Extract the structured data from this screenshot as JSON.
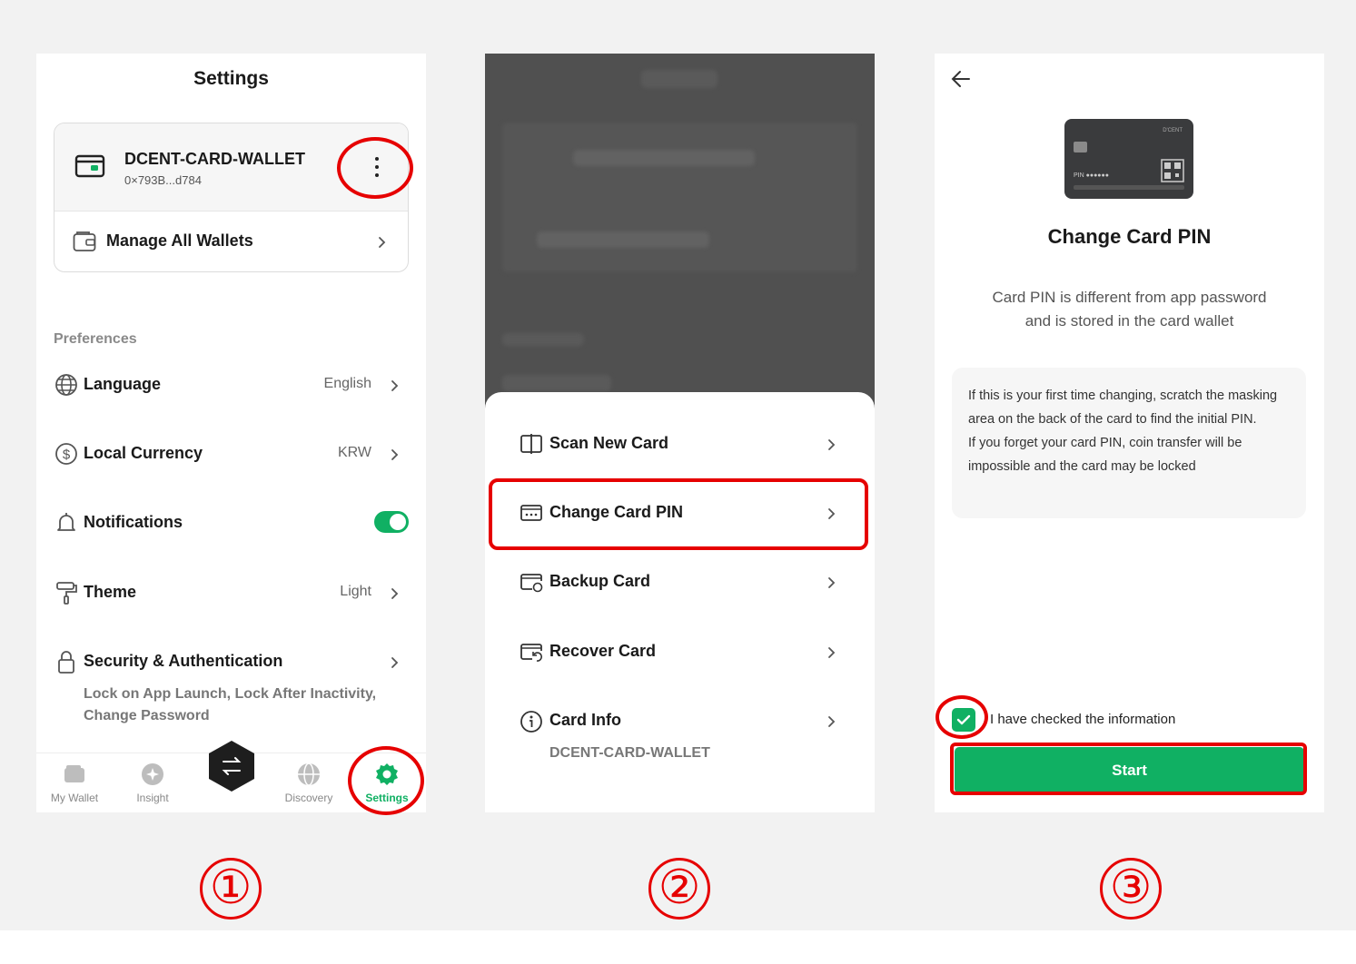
{
  "screen1": {
    "title": "Settings",
    "wallet": {
      "name": "DCENT-CARD-WALLET",
      "address": "0×793B...d784"
    },
    "manage_label": "Manage All Wallets",
    "section_label": "Preferences",
    "prefs": [
      {
        "label": "Language",
        "value": "English",
        "icon": "globe-icon"
      },
      {
        "label": "Local Currency",
        "value": "KRW",
        "icon": "dollar-icon"
      },
      {
        "label": "Notifications",
        "value": "",
        "icon": "bell-icon",
        "toggle_on": true
      },
      {
        "label": "Theme",
        "value": "Light",
        "icon": "paint-roller-icon"
      },
      {
        "label": "Security & Authentication",
        "value": "",
        "icon": "lock-icon"
      }
    ],
    "security_desc": "Lock on App Launch, Lock After Inactivity, Change Password",
    "tabs": [
      {
        "label": "My Wallet",
        "icon": "wallet-icon"
      },
      {
        "label": "Insight",
        "icon": "sparkle-icon"
      },
      {
        "label": "Discovery",
        "icon": "globe-icon"
      },
      {
        "label": "Settings",
        "icon": "gear-icon",
        "active": true
      }
    ]
  },
  "screen2": {
    "menu": [
      {
        "label": "Scan New Card",
        "icon": "scan-card-icon"
      },
      {
        "label": "Change Card PIN",
        "icon": "pin-card-icon"
      },
      {
        "label": "Backup Card",
        "icon": "backup-card-icon"
      },
      {
        "label": "Recover Card",
        "icon": "recover-card-icon"
      },
      {
        "label": "Card Info",
        "icon": "info-icon"
      }
    ],
    "card_info_sub": "DCENT-CARD-WALLET"
  },
  "screen3": {
    "title": "Change Card PIN",
    "desc_line1": "Card PIN is different from app password",
    "desc_line2": "and is stored in the card wallet",
    "info_line1": "If this is your first time changing, scratch the masking area on the back of the card to find the initial PIN.",
    "info_line2": "If you forget your card PIN, coin transfer will be impossible and the card may be locked",
    "card_pin_label": "PIN ●●●●●●",
    "card_brand": "D'CENT",
    "check_label": "I have checked the information",
    "start_label": "Start"
  },
  "steps": [
    "①",
    "②",
    "③"
  ],
  "colors": {
    "accent": "#10b063",
    "highlight": "#e60000"
  }
}
